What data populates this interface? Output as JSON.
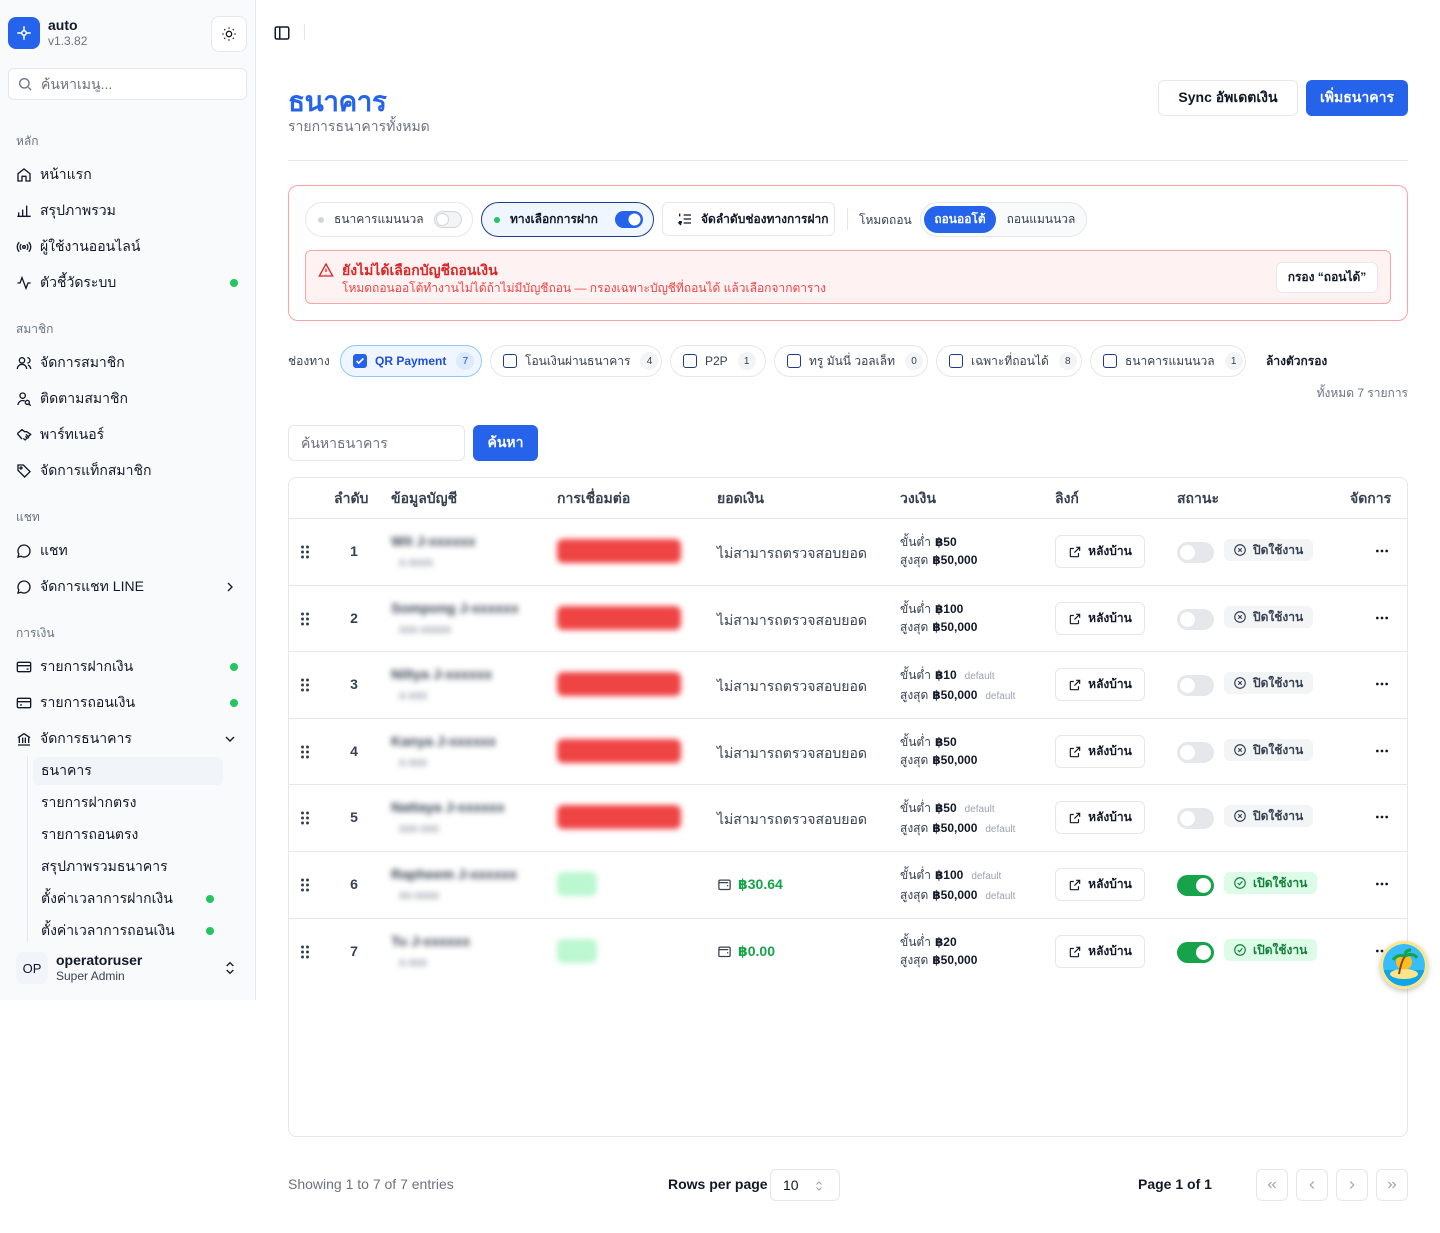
{
  "app": {
    "name": "auto",
    "version": "v1.3.82"
  },
  "sidebar": {
    "search_placeholder": "ค้นหาเมนู...",
    "groups": [
      "หลัก",
      "สมาชิก",
      "แชท",
      "การเงิน"
    ],
    "main_items": [
      {
        "label": "หน้าแรก",
        "icon": "home-icon"
      },
      {
        "label": "สรุปภาพรวม",
        "icon": "bar-chart-icon"
      },
      {
        "label": "ผู้ใช้งานออนไลน์",
        "icon": "broadcast-icon"
      },
      {
        "label": "ตัวชี้วัดระบบ",
        "icon": "activity-icon",
        "dot": true
      }
    ],
    "member_items": [
      {
        "label": "จัดการสมาชิก",
        "icon": "users-icon"
      },
      {
        "label": "ติดตามสมาชิก",
        "icon": "user-search-icon"
      },
      {
        "label": "พาร์ทเนอร์",
        "icon": "handshake-icon"
      },
      {
        "label": "จัดการแท็กสมาชิก",
        "icon": "tag-icon"
      }
    ],
    "chat_items": [
      {
        "label": "แชท",
        "icon": "message-circle-icon"
      },
      {
        "label": "จัดการแชท LINE",
        "icon": "message-circle-icon"
      }
    ],
    "finance_items": [
      {
        "label": "รายการฝากเงิน",
        "icon": "card-in-icon",
        "dot": true
      },
      {
        "label": "รายการถอนเงิน",
        "icon": "card-out-icon",
        "dot": true
      },
      {
        "label": "จัดการธนาคาร",
        "icon": "bank-icon"
      }
    ],
    "bank_sub": [
      {
        "label": "ธนาคาร"
      },
      {
        "label": "รายการฝากตรง"
      },
      {
        "label": "รายการถอนตรง"
      },
      {
        "label": "สรุปภาพรวมธนาคาร"
      },
      {
        "label": "ตั้งค่าเวลาการฝากเงิน"
      },
      {
        "label": "ตั้งค่าเวลาการถอนเงิน"
      }
    ],
    "user": {
      "initials": "OP",
      "name": "operatoruser",
      "role": "Super Admin"
    }
  },
  "page": {
    "title": "ธนาคาร",
    "subtitle": "รายการธนาคารทั้งหมด",
    "sync_label": "Sync อัพเดตเงิน",
    "add_label": "เพิ่มธนาคาร"
  },
  "filters": {
    "manual_bank": "ธนาคารแมนนวล",
    "deposit_option": "ทางเลือกการฝาก",
    "order_label": "จัดลำดับช่องทางการฝาก",
    "mode_label": "โหมดถอน",
    "mode_auto": "ถอนออโต้",
    "mode_manual": "ถอนแมนนวล",
    "alert_title": "ยังไม่ได้เลือกบัญชีถอนเงิน",
    "alert_desc": "โหมดถอนออโต้ทำงานไม่ได้ถ้าไม่มีบัญชีถอน — กรองเฉพาะบัญชีที่ถอนได้ แล้วเลือกจากตาราง",
    "alert_btn": "กรอง “ถอนได้”",
    "channel_label": "ช่องทาง",
    "chips": [
      {
        "label": "QR Payment",
        "count": "7"
      },
      {
        "label": "โอนเงินผ่านธนาคาร",
        "count": "4"
      },
      {
        "label": "P2P",
        "count": "1"
      },
      {
        "label": "ทรู มันนี่ วอลเล็ท",
        "count": "0"
      },
      {
        "label": "เฉพาะที่ถอนได้",
        "count": "8"
      },
      {
        "label": "ธนาคารแมนนวล",
        "count": "1"
      }
    ],
    "clear_label": "ล้างตัวกรอง",
    "total_label": "ทั้งหมด 7 รายการ"
  },
  "search": {
    "placeholder": "ค้นหาธนาคาร",
    "button": "ค้นหา"
  },
  "table": {
    "headers": [
      "ลำดับ",
      "ข้อมูลบัญชี",
      "การเชื่อมต่อ",
      "ยอดเงิน",
      "วงเงิน",
      "ลิงก์",
      "สถานะ",
      "จัดการ"
    ],
    "min_label": "ขั้นต่ำ",
    "max_label": "สูงสุด",
    "default_label": "default",
    "link_label": "หลังบ้าน",
    "rows": [
      {
        "no": "1",
        "name": "Wit J-xxxxxx",
        "acc": "x-xxxx",
        "balance": "ไม่สามารถตรวจสอบยอด",
        "min": "฿50",
        "max": "฿50,000",
        "status": "ปิดใช้งาน"
      },
      {
        "no": "2",
        "name": "Sompong J-xxxxxx",
        "acc": "xxx-xxxxx",
        "balance": "ไม่สามารถตรวจสอบยอด",
        "min": "฿100",
        "max": "฿50,000",
        "status": "ปิดใช้งาน"
      },
      {
        "no": "3",
        "name": "Niltya J-xxxxxx",
        "acc": "x-xxx",
        "balance": "ไม่สามารถตรวจสอบยอด",
        "min": "฿10",
        "max": "฿50,000",
        "status": "ปิดใช้งาน"
      },
      {
        "no": "4",
        "name": "Kanya J-xxxxxx",
        "acc": "x-xxx",
        "balance": "ไม่สามารถตรวจสอบยอด",
        "min": "฿50",
        "max": "฿50,000",
        "status": "ปิดใช้งาน"
      },
      {
        "no": "5",
        "name": "Nattaya J-xxxxxx",
        "acc": "xxx-xxx",
        "balance": "ไม่สามารถตรวจสอบยอด",
        "min": "฿50",
        "max": "฿50,000",
        "status": "ปิดใช้งาน"
      },
      {
        "no": "6",
        "name": "Rapheem J-xxxxxx",
        "acc": "xx-xxxx",
        "balance": "฿30.64",
        "min": "฿100",
        "max": "฿50,000",
        "status": "เปิดใช้งาน"
      },
      {
        "no": "7",
        "name": "Tu J-xxxxxx",
        "acc": "x-xxx",
        "balance": "฿0.00",
        "min": "฿20",
        "max": "฿50,000",
        "status": "เปิดใช้งาน"
      }
    ]
  },
  "footer": {
    "showing": "Showing 1 to 7 of 7 entries",
    "rows_per_page_label": "Rows per page",
    "rows_per_page": "10",
    "page_info": "Page 1 of 1"
  },
  "colors": {
    "accent": "#2563eb",
    "success": "#16a34a",
    "danger": "#dc2626"
  }
}
